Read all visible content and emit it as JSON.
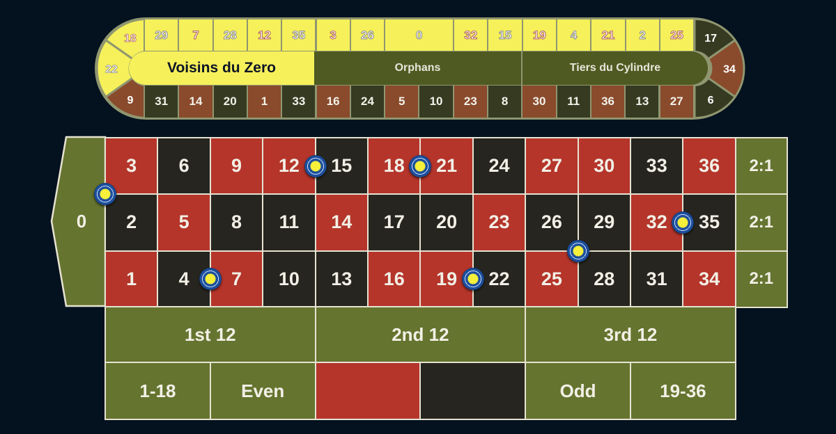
{
  "racetrack": {
    "left_end": [
      {
        "n": "18",
        "c": "yellow"
      },
      {
        "n": "22",
        "c": "yellow"
      },
      {
        "n": "9",
        "c": "red"
      }
    ],
    "right_end": [
      {
        "n": "17",
        "c": "black"
      },
      {
        "n": "34",
        "c": "red"
      },
      {
        "n": "6",
        "c": "black"
      }
    ],
    "top": [
      "29",
      "7",
      "28",
      "12",
      "35",
      "3",
      "26",
      "0",
      "32",
      "15",
      "19",
      "4",
      "21",
      "2",
      "25"
    ],
    "top_red": [
      "7",
      "12",
      "3",
      "32",
      "19",
      "21",
      "25",
      "18"
    ],
    "bottom": [
      {
        "n": "31",
        "c": "black"
      },
      {
        "n": "14",
        "c": "red"
      },
      {
        "n": "20",
        "c": "black"
      },
      {
        "n": "1",
        "c": "red"
      },
      {
        "n": "33",
        "c": "black"
      },
      {
        "n": "16",
        "c": "red"
      },
      {
        "n": "24",
        "c": "black"
      },
      {
        "n": "5",
        "c": "red"
      },
      {
        "n": "10",
        "c": "black"
      },
      {
        "n": "23",
        "c": "red"
      },
      {
        "n": "8",
        "c": "black"
      },
      {
        "n": "30",
        "c": "red"
      },
      {
        "n": "11",
        "c": "black"
      },
      {
        "n": "36",
        "c": "red"
      },
      {
        "n": "13",
        "c": "black"
      },
      {
        "n": "27",
        "c": "red"
      }
    ],
    "sections": {
      "voisins": "Voisins du Zero",
      "orphans": "Orphans",
      "tiers": "Tiers du Cylindre"
    }
  },
  "board": {
    "zero": "0",
    "rows": [
      [
        "3",
        "6",
        "9",
        "12",
        "15",
        "18",
        "21",
        "24",
        "27",
        "30",
        "33",
        "36"
      ],
      [
        "2",
        "5",
        "8",
        "11",
        "14",
        "17",
        "20",
        "23",
        "26",
        "29",
        "32",
        "35"
      ],
      [
        "1",
        "4",
        "7",
        "10",
        "13",
        "16",
        "19",
        "22",
        "25",
        "28",
        "31",
        "34"
      ]
    ],
    "red_numbers": [
      "1",
      "3",
      "5",
      "7",
      "9",
      "12",
      "14",
      "16",
      "18",
      "19",
      "21",
      "23",
      "25",
      "27",
      "30",
      "32",
      "34",
      "36"
    ],
    "columns": [
      "2:1",
      "2:1",
      "2:1"
    ],
    "dozens": [
      "1st 12",
      "2nd 12",
      "3rd 12"
    ],
    "outside": [
      {
        "label": "1-18",
        "color": "green"
      },
      {
        "label": "Even",
        "color": "green"
      },
      {
        "label": "",
        "color": "red",
        "name": "red-bet"
      },
      {
        "label": "",
        "color": "black",
        "name": "black-bet"
      },
      {
        "label": "Odd",
        "color": "green"
      },
      {
        "label": "19-36",
        "color": "green"
      }
    ]
  },
  "bets": [
    [
      "0",
      "2",
      "3"
    ],
    [
      "12",
      "15"
    ],
    [
      "18",
      "21"
    ],
    [
      "4",
      "7"
    ],
    [
      "25",
      "26",
      "28",
      "29"
    ],
    [
      "32",
      "35"
    ],
    [
      "19",
      "22"
    ]
  ],
  "colors": {
    "red": "#b5352b",
    "black": "#27251f",
    "green": "#65742f",
    "yellow": "#f6f05a",
    "chip": "#1d4f9c"
  }
}
